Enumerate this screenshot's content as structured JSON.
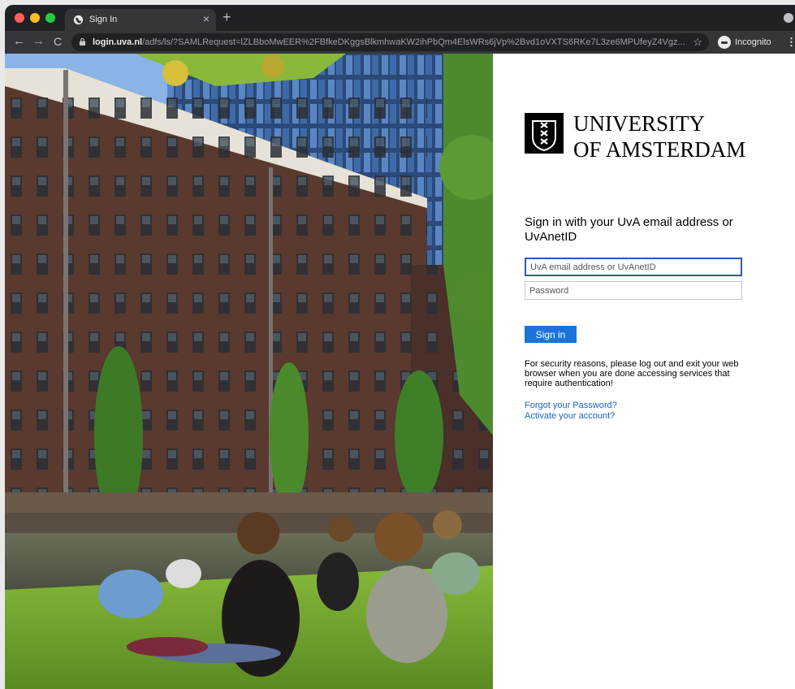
{
  "browser": {
    "tab_title": "Sign In",
    "new_tab": "+",
    "tab_close": "×",
    "url_host": "login.uva.nl",
    "url_path": "/adfs/ls/?SAMLRequest=lZLBboMwEER%2FBfkeDKggsBlkmhwaKW2ihPbQm4ElsWRs6jVp%2Bvd1oVXTS6RKe7L3ze6MPUfeyZ4Vgz...",
    "incognito_label": "Incognito",
    "icons": [
      "back-arrow-icon",
      "forward-arrow-icon",
      "reload-icon",
      "lock-icon",
      "star-icon",
      "incognito-icon",
      "menu-icon"
    ]
  },
  "logo": {
    "line1": "UNIVERSITY",
    "line2": "OF AMSTERDAM"
  },
  "login": {
    "heading": "Sign in with your UvA email address or UvAnetID",
    "email_placeholder": "UvA email address or UvAnetID",
    "email_value": "",
    "password_placeholder": "Password",
    "sign_in_label": "Sign in",
    "security_notice": "For security reasons, please log out and exit your web browser when you are done accessing services that require authentication!",
    "forgot_password": "Forgot your Password?",
    "activate_account": "Activate your account?"
  },
  "colors": {
    "chrome_dark": "#202124",
    "chrome_toolbar": "#35363a",
    "button_blue": "#1a73d9",
    "link_blue": "#1a63c6",
    "focus_border": "#2b5ca6"
  }
}
